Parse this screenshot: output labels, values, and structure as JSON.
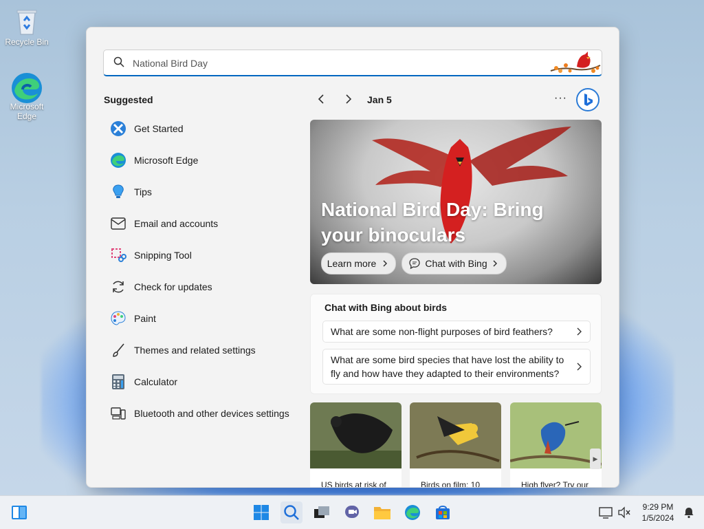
{
  "desktop": {
    "icons": [
      {
        "label": "Recycle Bin"
      },
      {
        "label": "Microsoft Edge"
      }
    ]
  },
  "search": {
    "value": "National Bird Day"
  },
  "suggested": {
    "title": "Suggested",
    "items": [
      {
        "label": "Get Started",
        "icon": "get-started-icon"
      },
      {
        "label": "Microsoft Edge",
        "icon": "edge-icon"
      },
      {
        "label": "Tips",
        "icon": "tips-icon"
      },
      {
        "label": "Email and accounts",
        "icon": "mail-icon"
      },
      {
        "label": "Snipping Tool",
        "icon": "snipping-tool-icon"
      },
      {
        "label": "Check for updates",
        "icon": "refresh-icon"
      },
      {
        "label": "Paint",
        "icon": "paint-icon"
      },
      {
        "label": "Themes and related settings",
        "icon": "brush-icon"
      },
      {
        "label": "Calculator",
        "icon": "calculator-icon"
      },
      {
        "label": "Bluetooth and other devices settings",
        "icon": "devices-icon"
      }
    ]
  },
  "highlights": {
    "date": "Jan 5",
    "more": "···",
    "hero": {
      "title": "National Bird Day: Bring your binoculars",
      "learn_more": "Learn more",
      "chat_with_bing": "Chat with Bing"
    },
    "chat": {
      "title": "Chat with Bing about birds",
      "questions": [
        "What are some non-flight purposes of bird feathers?",
        "What are some bird species that have lost the ability to fly and how have they adapted to their environments?"
      ]
    },
    "cards": [
      {
        "caption": "US birds at risk of"
      },
      {
        "caption": "Birds on film: 10"
      },
      {
        "caption": "High flyer? Try our"
      }
    ]
  },
  "taskbar": {
    "time": "9:29 PM",
    "date": "1/5/2024"
  },
  "colors": {
    "accent": "#0067c0",
    "cardinal": "#d42020"
  }
}
